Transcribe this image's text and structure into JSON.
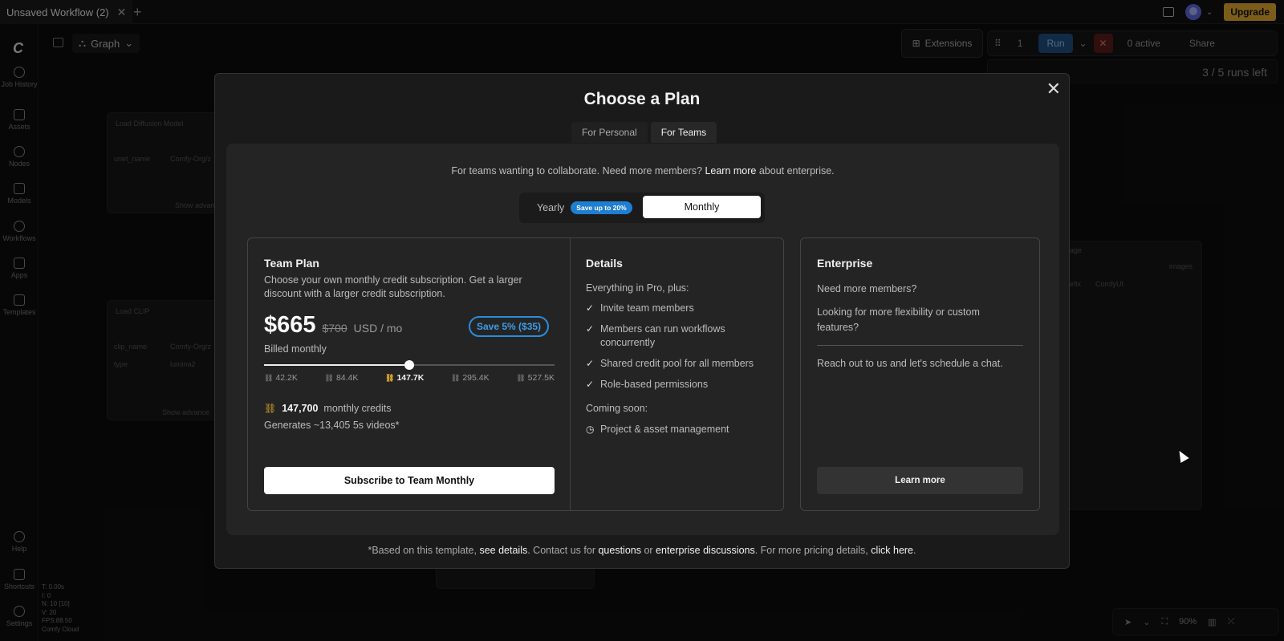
{
  "tabs": {
    "workflow_title": "Unsaved Workflow (2)",
    "close": "✕",
    "new_tab": "+"
  },
  "topbar": {
    "upgrade_label": "Upgrade"
  },
  "sidebar": {
    "items": [
      {
        "label": "Job History",
        "icon": "history-icon"
      },
      {
        "label": "Assets",
        "icon": "image-icon"
      },
      {
        "label": "Nodes",
        "icon": "node-icon"
      },
      {
        "label": "Models",
        "icon": "cube-icon"
      },
      {
        "label": "Workflows",
        "icon": "workflow-icon"
      },
      {
        "label": "Apps",
        "icon": "apps-icon"
      },
      {
        "label": "Templates",
        "icon": "templates-icon"
      },
      {
        "label": "Help",
        "icon": "help-icon"
      },
      {
        "label": "Shortcuts",
        "icon": "keyboard-icon"
      },
      {
        "label": "Settings",
        "icon": "gear-icon"
      }
    ],
    "stats": [
      "T: 0.00s",
      "I: 0",
      "N: 10 [10]",
      "V: 20",
      "FPS:88.50",
      "Comfy Cloud"
    ]
  },
  "canvas": {
    "graph_label": "Graph",
    "extensions_label": "Extensions",
    "batch_count": "1",
    "run_label": "Run",
    "active_label": "0 active",
    "share_label": "Share",
    "runs_left": "3 / 5 runs left",
    "zoom": "90%",
    "nodes": {
      "diffusion_title": "Load Diffusion Model",
      "diffusion_field": "unet_name",
      "diffusion_value": "Comfy-Org/z",
      "diffusion_adv": "Show advan",
      "clip_title": "Load CLIP",
      "clip_field": "clip_name",
      "clip_value": "Comfy-Org/z",
      "clip_type": "type",
      "clip_type_value": "lumina2",
      "clip_adv": "Show advance",
      "right_out": "images",
      "right_prefix": "efix",
      "right_value": "ComfyUI",
      "right_title": "age"
    }
  },
  "modal": {
    "title": "Choose a Plan",
    "close": "✕",
    "tabs": [
      {
        "label": "For Personal",
        "active": false
      },
      {
        "label": "For Teams",
        "active": true
      }
    ],
    "intro_prefix": "For teams wanting to collaborate. Need more members? ",
    "intro_link": "Learn more",
    "intro_suffix": " about enterprise.",
    "billing": {
      "yearly": "Yearly",
      "save_pill": "Save up to 20%",
      "monthly": "Monthly",
      "selected": "Monthly"
    },
    "team": {
      "title": "Team Plan",
      "description": "Choose your own monthly credit subscription. Get a larger discount with a larger credit subscription.",
      "price": "$665",
      "old_price": "$700",
      "unit": "USD / mo",
      "save_badge": "Save 5% ($35)",
      "billed": "Billed monthly",
      "slider_fraction": 0.5,
      "tiers": [
        "42.2K",
        "84.4K",
        "147.7K",
        "295.4K",
        "527.5K"
      ],
      "selected_tier": "147.7K",
      "credits_amount": "147,700",
      "credits_label": "monthly credits",
      "generates": "Generates ~13,405 5s videos*",
      "subscribe_label": "Subscribe to Team Monthly"
    },
    "details": {
      "title": "Details",
      "subtitle": "Everything in Pro, plus:",
      "items": [
        "Invite team members",
        "Members can run workflows concurrently",
        "Shared credit pool for all members",
        "Role-based permissions"
      ],
      "coming_soon": "Coming soon:",
      "soon_items": [
        "Project & asset management"
      ]
    },
    "enterprise": {
      "title": "Enterprise",
      "line1": "Need more members?",
      "line2": "Looking for more flexibility or custom features?",
      "line3": "Reach out to us and let's schedule a chat.",
      "button": "Learn more"
    },
    "footer": {
      "p1": "*Based on this template, ",
      "l1": "see details",
      "p2": ". Contact us for ",
      "l2": "questions",
      "p3": " or ",
      "l3": "enterprise discussions",
      "p4": ". For more pricing details, ",
      "l4": "click here",
      "p5": "."
    }
  },
  "colors": {
    "accent_blue": "#2a8cde",
    "upgrade": "#e1a82f",
    "credit_gold": "#e2a92e"
  }
}
